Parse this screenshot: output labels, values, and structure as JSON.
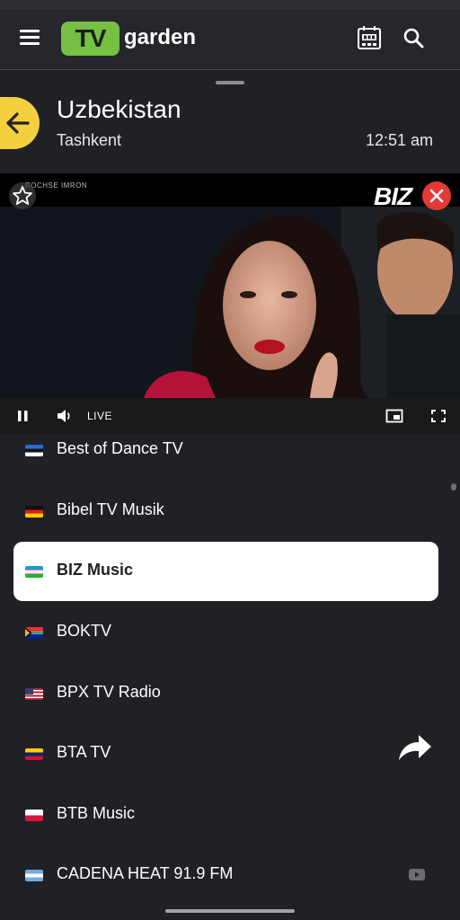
{
  "header": {
    "logo_tv": "TV",
    "logo_word": "garden",
    "icons": [
      "menu-icon",
      "tv-guide-icon",
      "search-icon"
    ]
  },
  "location": {
    "country": "Uzbekistan",
    "city": "Tashkent",
    "time": "12:51 am"
  },
  "player": {
    "overlay_credit": "ROCHSE IMRON",
    "channel_logo": "BIZ",
    "live_label": "LIVE",
    "icons": [
      "star-icon",
      "close-icon",
      "pause-icon",
      "volume-icon",
      "picture-in-picture-icon",
      "fullscreen-icon"
    ]
  },
  "channels": [
    {
      "name": "Best of Dance TV",
      "flag": "estonia",
      "selected": false
    },
    {
      "name": "Bibel TV Musik",
      "flag": "germany",
      "selected": false
    },
    {
      "name": "BIZ Music",
      "flag": "uzbekistan",
      "selected": true
    },
    {
      "name": "BOKTV",
      "flag": "south-africa",
      "selected": false
    },
    {
      "name": "BPX TV Radio",
      "flag": "usa",
      "selected": false
    },
    {
      "name": "BTA TV",
      "flag": "venezuela",
      "selected": false
    },
    {
      "name": "BTB Music",
      "flag": "poland",
      "selected": false
    },
    {
      "name": "CADENA HEAT 91.9 FM",
      "flag": "argentina",
      "selected": false,
      "youtube": true
    }
  ],
  "colors": {
    "brand_green": "#76c043",
    "back_yellow": "#f4d03f",
    "close_red": "#e53935",
    "background": "#1f2126"
  }
}
